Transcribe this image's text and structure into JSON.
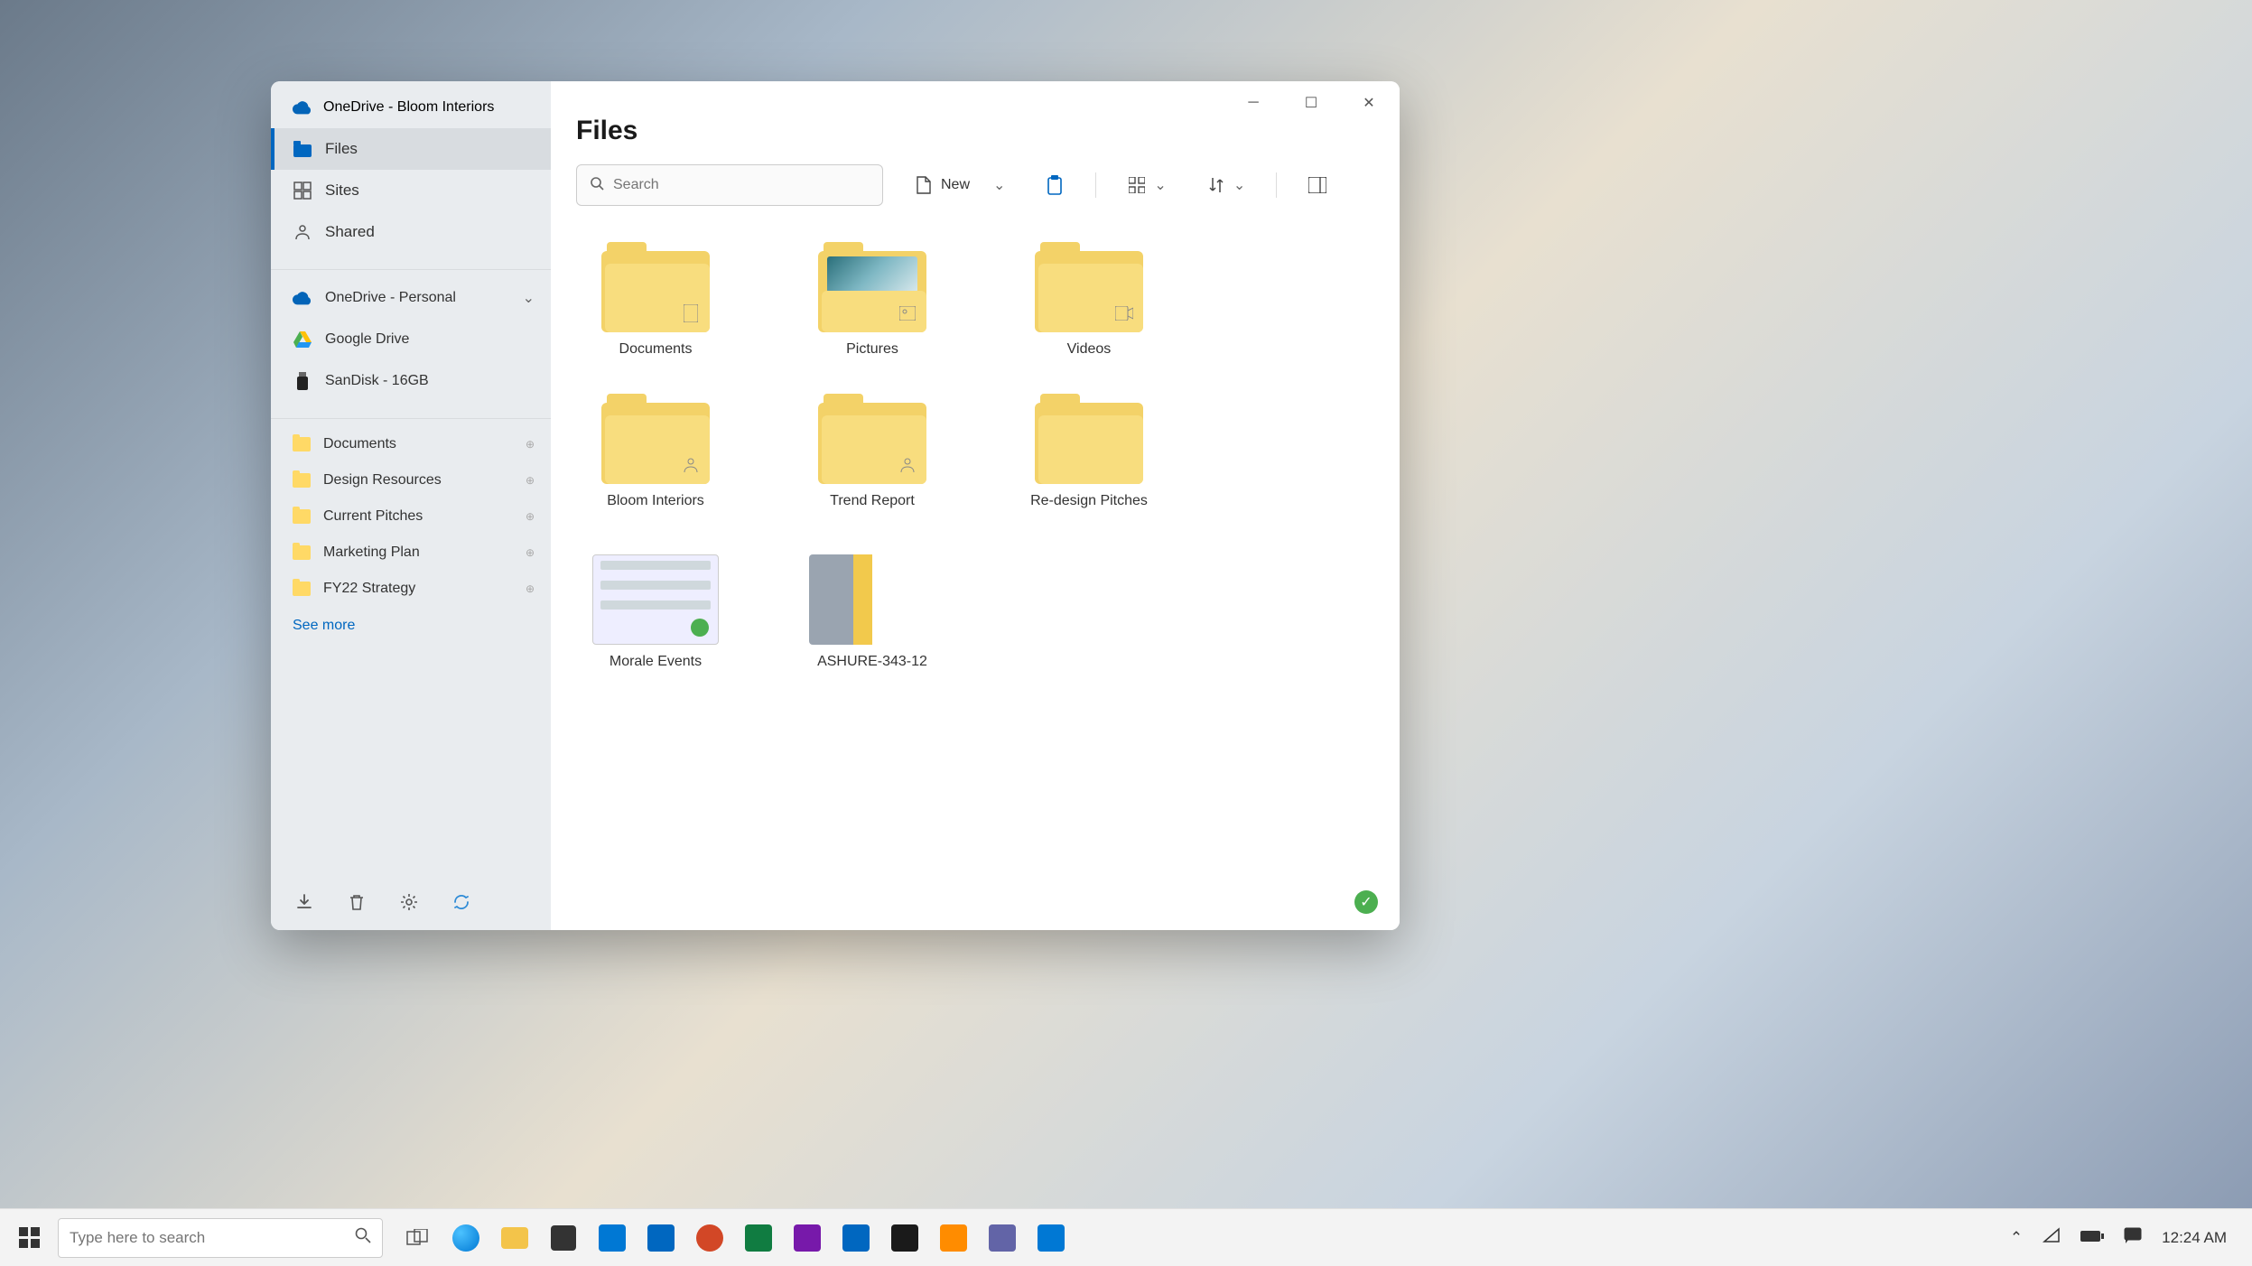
{
  "window": {
    "account_title": "OneDrive - Bloom Interiors",
    "nav": [
      {
        "label": "Files",
        "icon": "files-icon",
        "active": true
      },
      {
        "label": "Sites",
        "icon": "sites-icon",
        "active": false
      },
      {
        "label": "Shared",
        "icon": "shared-icon",
        "active": false
      }
    ],
    "accounts": [
      {
        "label": "OneDrive - Personal",
        "icon": "onedrive-icon",
        "expandable": true
      },
      {
        "label": "Google Drive",
        "icon": "gdrive-icon",
        "expandable": false
      },
      {
        "label": "SanDisk - 16GB",
        "icon": "usb-icon",
        "expandable": false
      }
    ],
    "quick_access": [
      {
        "label": "Documents"
      },
      {
        "label": "Design Resources"
      },
      {
        "label": "Current Pitches"
      },
      {
        "label": "Marketing Plan"
      },
      {
        "label": "FY22 Strategy"
      }
    ],
    "see_more": "See more",
    "page_title": "Files",
    "search": {
      "placeholder": "Search"
    },
    "toolbar": {
      "new_label": "New",
      "view_label": "",
      "sort_label": ""
    },
    "items": [
      {
        "label": "Documents",
        "type": "folder",
        "badge": "doc"
      },
      {
        "label": "Pictures",
        "type": "folder-thumb",
        "badge": "pic"
      },
      {
        "label": "Videos",
        "type": "folder",
        "badge": "vid"
      },
      {
        "label": "Bloom Interiors",
        "type": "folder",
        "badge": "share"
      },
      {
        "label": "Trend Report",
        "type": "folder",
        "badge": "share"
      },
      {
        "label": "Re-design Pitches",
        "type": "folder",
        "badge": ""
      },
      {
        "label": "Morale Events",
        "type": "file"
      },
      {
        "label": "ASHURE-343-12",
        "type": "image"
      }
    ]
  },
  "taskbar": {
    "search_placeholder": "Type here to search",
    "clock": "12:24 AM",
    "apps": [
      {
        "name": "task-view",
        "color": "#555"
      },
      {
        "name": "edge",
        "color": "#0078d4"
      },
      {
        "name": "explorer",
        "color": "#f3c44a"
      },
      {
        "name": "store",
        "color": "#333"
      },
      {
        "name": "mail",
        "color": "#0078d4"
      },
      {
        "name": "calendar",
        "color": "#0067c0"
      },
      {
        "name": "powerpoint",
        "color": "#d24726"
      },
      {
        "name": "excel",
        "color": "#107c41"
      },
      {
        "name": "onenote",
        "color": "#7719aa"
      },
      {
        "name": "photos",
        "color": "#0067c0"
      },
      {
        "name": "app1",
        "color": "#1a1a1a"
      },
      {
        "name": "app2",
        "color": "#ff8c00"
      },
      {
        "name": "teams",
        "color": "#6264a7"
      },
      {
        "name": "app3",
        "color": "#0078d4"
      }
    ]
  }
}
